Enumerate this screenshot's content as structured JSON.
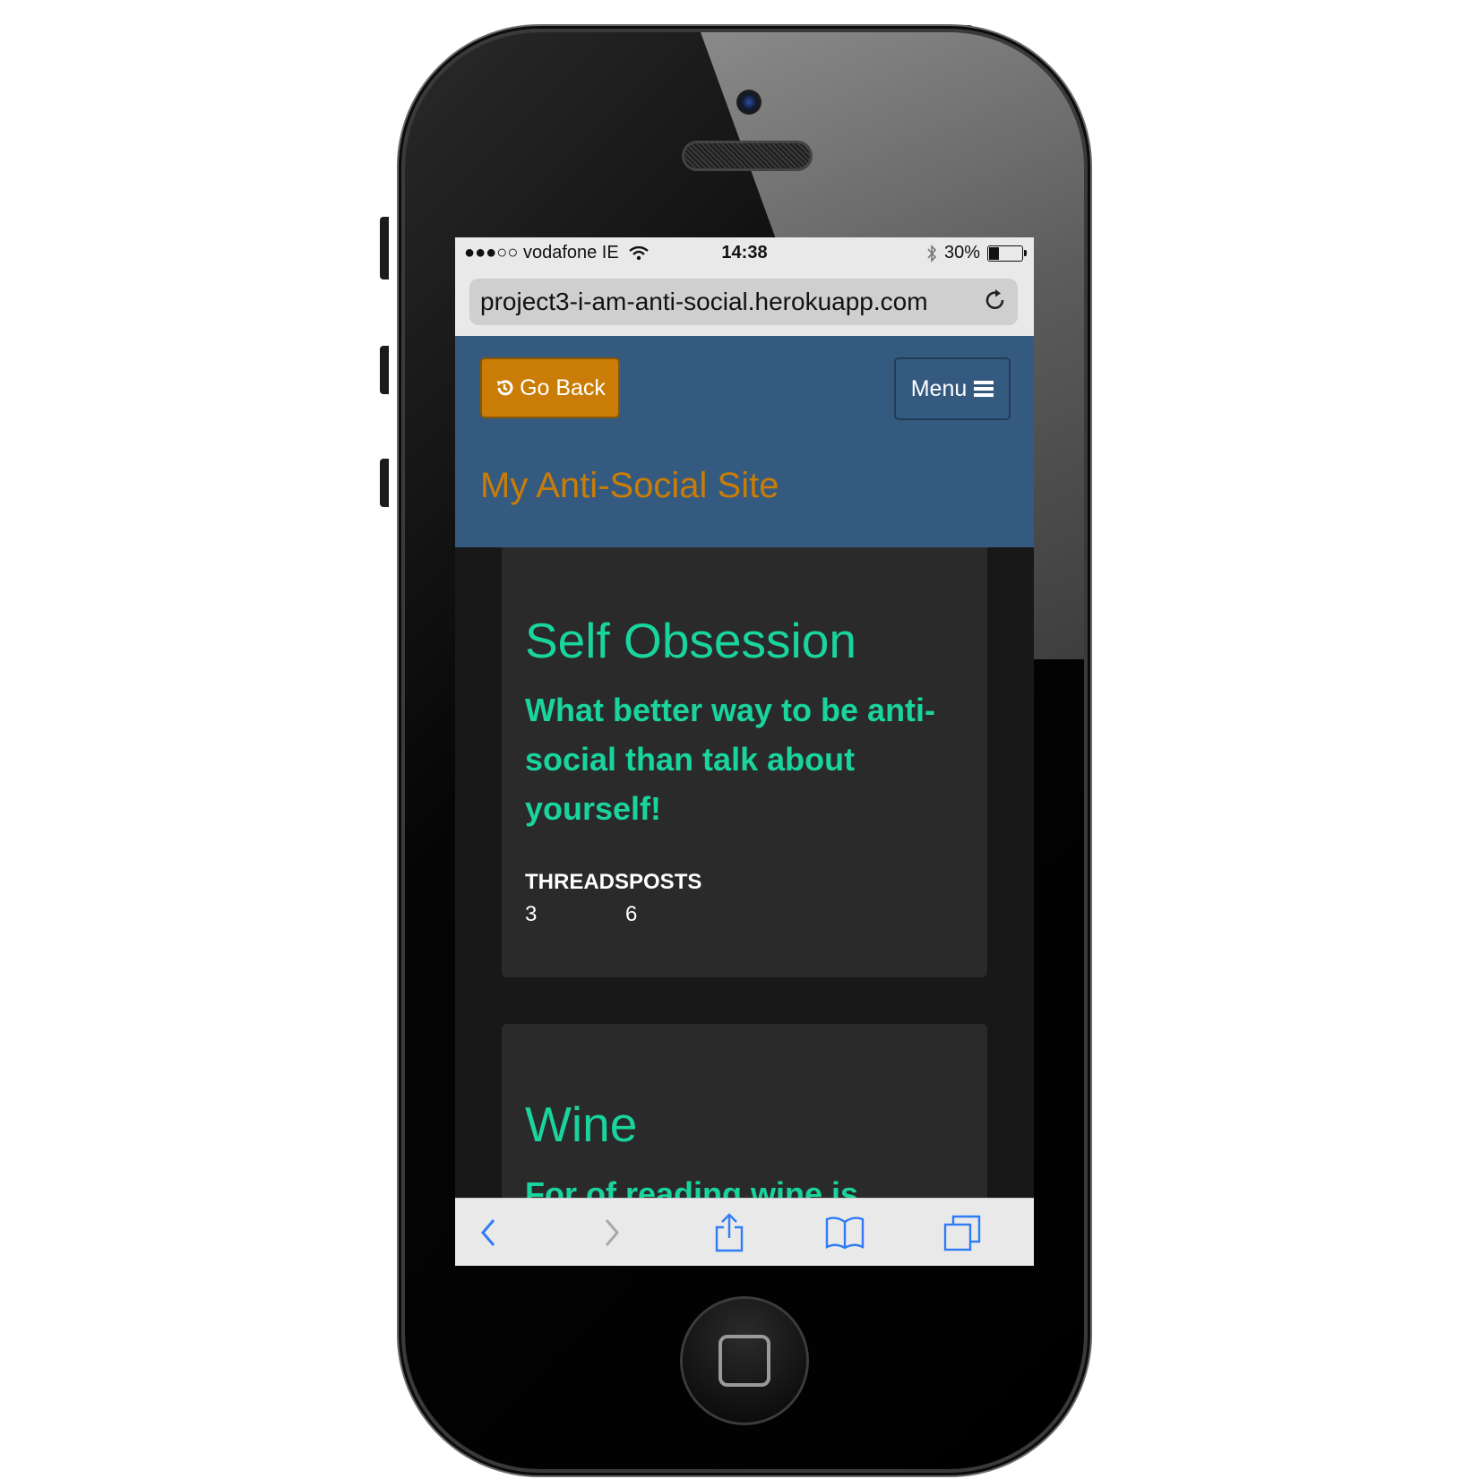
{
  "status_bar": {
    "carrier": "●●●○○ vodafone IE",
    "time": "14:38",
    "battery_text": "30%",
    "battery_level": 0.3
  },
  "browser": {
    "url": "project3-i-am-anti-social.herokuapp.com"
  },
  "navbar": {
    "go_back_label": "Go Back",
    "menu_label": "Menu",
    "site_title": "My Anti-Social Site"
  },
  "forums": [
    {
      "title": "Self Obsession",
      "description": "What better way to be anti-social than talk about yourself!",
      "stats_header": "THREADSPOSTS",
      "threads": "3",
      "posts": "6"
    },
    {
      "title": "Wine",
      "description": "For of reading wine is"
    }
  ],
  "colors": {
    "navbar_bg": "#355a80",
    "accent_orange": "#c97d06",
    "accent_green": "#1ad49e",
    "card_bg": "#2a2a2a",
    "page_bg": "#181818"
  },
  "icons": {
    "go_back": "history-icon",
    "menu": "hamburger-icon",
    "reload": "reload-icon",
    "back": "chevron-left-icon",
    "forward": "chevron-right-icon",
    "share": "share-icon",
    "bookmarks": "book-icon",
    "tabs": "tabs-icon"
  }
}
